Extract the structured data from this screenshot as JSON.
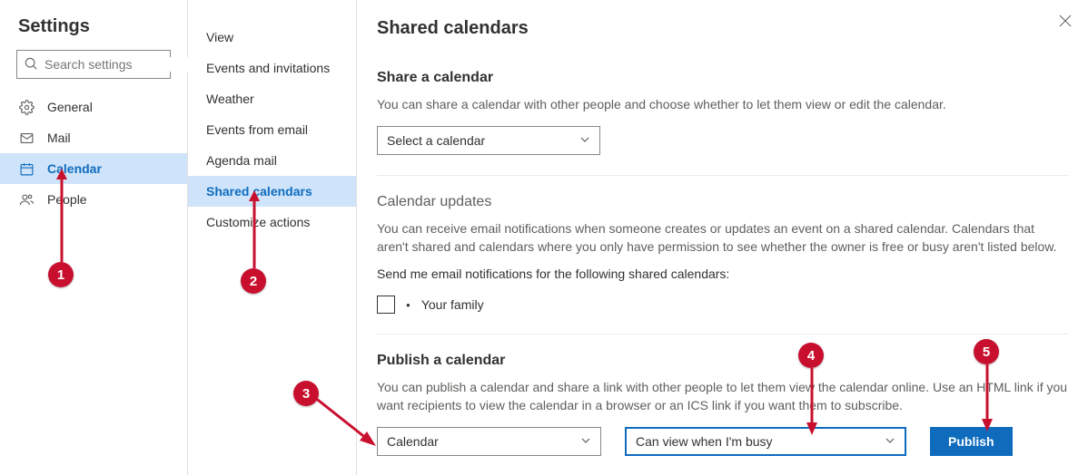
{
  "settings": {
    "title": "Settings",
    "search_placeholder": "Search settings",
    "items": [
      {
        "label": "General"
      },
      {
        "label": "Mail"
      },
      {
        "label": "Calendar"
      },
      {
        "label": "People"
      }
    ]
  },
  "submenu": {
    "items": [
      {
        "label": "View"
      },
      {
        "label": "Events and invitations"
      },
      {
        "label": "Weather"
      },
      {
        "label": "Events from email"
      },
      {
        "label": "Agenda mail"
      },
      {
        "label": "Shared calendars"
      },
      {
        "label": "Customize actions"
      }
    ]
  },
  "main": {
    "title": "Shared calendars",
    "share": {
      "heading": "Share a calendar",
      "desc": "You can share a calendar with other people and choose whether to let them view or edit the calendar.",
      "select_placeholder": "Select a calendar"
    },
    "updates": {
      "heading": "Calendar updates",
      "desc": "You can receive email notifications when someone creates or updates an event on a shared calendar. Calendars that aren't shared and calendars where you only have permission to see whether the owner is free or busy aren't listed below.",
      "prompt": "Send me email notifications for the following shared calendars:",
      "option": "Your family"
    },
    "publish": {
      "heading": "Publish a calendar",
      "desc": "You can publish a calendar and share a link with other people to let them view the calendar online. Use an HTML link if you want recipients to view the calendar in a browser or an ICS link if you want them to subscribe.",
      "calendar_selected": "Calendar",
      "permission_selected": "Can view when I'm busy",
      "button": "Publish"
    }
  },
  "annotations": {
    "b1": "1",
    "b2": "2",
    "b3": "3",
    "b4": "4",
    "b5": "5"
  }
}
